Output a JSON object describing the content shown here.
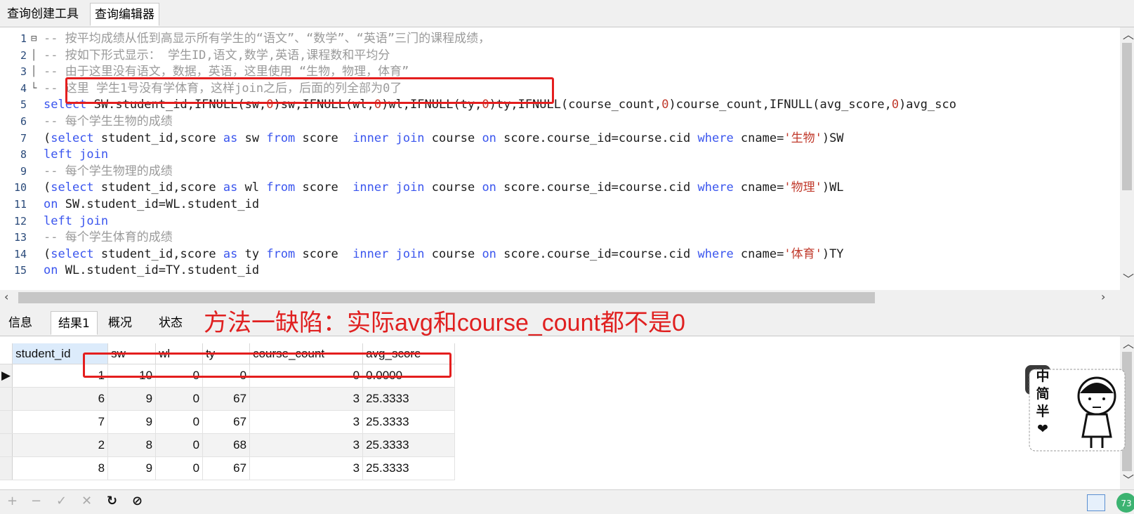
{
  "tabs": {
    "query_builder": "查询创建工具",
    "query_editor": "查询编辑器"
  },
  "editor": {
    "lines": [
      {
        "n": "1",
        "fold": "⊟",
        "parts": [
          {
            "c": "cmt",
            "t": "-- 按平均成绩从低到高显示所有学生的“语文”、“数学”、“英语”三门的课程成绩，"
          }
        ]
      },
      {
        "n": "2",
        "fold": "│",
        "parts": [
          {
            "c": "cmt",
            "t": "-- 按如下形式显示： 学生ID,语文,数学,英语,课程数和平均分"
          }
        ]
      },
      {
        "n": "3",
        "fold": "│",
        "parts": [
          {
            "c": "cmt",
            "t": "-- 由于这里没有语文，数据，英语，这里使用 “生物，物理，体育”"
          }
        ]
      },
      {
        "n": "4",
        "fold": "└",
        "parts": [
          {
            "c": "cmt",
            "t": "-- 这里 学生1号没有学体育，这样join之后，后面的列全部为0了"
          }
        ]
      },
      {
        "n": "5",
        "fold": "",
        "parts": [
          {
            "c": "kw",
            "t": "select"
          },
          {
            "c": "",
            "t": " SW.student_id,IFNULL(sw,"
          },
          {
            "c": "num",
            "t": "0"
          },
          {
            "c": "",
            "t": ")sw,IFNULL(wl,"
          },
          {
            "c": "num",
            "t": "0"
          },
          {
            "c": "",
            "t": ")wl,IFNULL(ty,"
          },
          {
            "c": "num",
            "t": "0"
          },
          {
            "c": "",
            "t": ")ty,IFNULL(course_count,"
          },
          {
            "c": "num",
            "t": "0"
          },
          {
            "c": "",
            "t": ")course_count,IFNULL(avg_score,"
          },
          {
            "c": "num",
            "t": "0"
          },
          {
            "c": "",
            "t": ")avg_sco"
          }
        ]
      },
      {
        "n": "6",
        "fold": "",
        "parts": [
          {
            "c": "cmt",
            "t": "-- 每个学生生物的成绩"
          }
        ]
      },
      {
        "n": "7",
        "fold": "",
        "parts": [
          {
            "c": "",
            "t": "("
          },
          {
            "c": "kw",
            "t": "select"
          },
          {
            "c": "",
            "t": " student_id,score "
          },
          {
            "c": "kw",
            "t": "as"
          },
          {
            "c": "",
            "t": " sw "
          },
          {
            "c": "kw",
            "t": "from"
          },
          {
            "c": "",
            "t": " score  "
          },
          {
            "c": "kw",
            "t": "inner join"
          },
          {
            "c": "",
            "t": " course "
          },
          {
            "c": "kw",
            "t": "on"
          },
          {
            "c": "",
            "t": " score.course_id=course.cid "
          },
          {
            "c": "kw",
            "t": "where"
          },
          {
            "c": "",
            "t": " cname="
          },
          {
            "c": "str",
            "t": "'生物'"
          },
          {
            "c": "",
            "t": ")SW"
          }
        ]
      },
      {
        "n": "8",
        "fold": "",
        "parts": [
          {
            "c": "kw",
            "t": "left join"
          }
        ]
      },
      {
        "n": "9",
        "fold": "",
        "parts": [
          {
            "c": "cmt",
            "t": "-- 每个学生物理的成绩"
          }
        ]
      },
      {
        "n": "10",
        "fold": "",
        "parts": [
          {
            "c": "",
            "t": "("
          },
          {
            "c": "kw",
            "t": "select"
          },
          {
            "c": "",
            "t": " student_id,score "
          },
          {
            "c": "kw",
            "t": "as"
          },
          {
            "c": "",
            "t": " wl "
          },
          {
            "c": "kw",
            "t": "from"
          },
          {
            "c": "",
            "t": " score  "
          },
          {
            "c": "kw",
            "t": "inner join"
          },
          {
            "c": "",
            "t": " course "
          },
          {
            "c": "kw",
            "t": "on"
          },
          {
            "c": "",
            "t": " score.course_id=course.cid "
          },
          {
            "c": "kw",
            "t": "where"
          },
          {
            "c": "",
            "t": " cname="
          },
          {
            "c": "str",
            "t": "'物理'"
          },
          {
            "c": "",
            "t": ")WL"
          }
        ]
      },
      {
        "n": "11",
        "fold": "",
        "parts": [
          {
            "c": "kw",
            "t": "on"
          },
          {
            "c": "",
            "t": " SW.student_id=WL.student_id"
          }
        ]
      },
      {
        "n": "12",
        "fold": "",
        "parts": [
          {
            "c": "kw",
            "t": "left join"
          }
        ]
      },
      {
        "n": "13",
        "fold": "",
        "parts": [
          {
            "c": "cmt",
            "t": "-- 每个学生体育的成绩"
          }
        ]
      },
      {
        "n": "14",
        "fold": "",
        "parts": [
          {
            "c": "",
            "t": "("
          },
          {
            "c": "kw",
            "t": "select"
          },
          {
            "c": "",
            "t": " student_id,score "
          },
          {
            "c": "kw",
            "t": "as"
          },
          {
            "c": "",
            "t": " ty "
          },
          {
            "c": "kw",
            "t": "from"
          },
          {
            "c": "",
            "t": " score  "
          },
          {
            "c": "kw",
            "t": "inner join"
          },
          {
            "c": "",
            "t": " course "
          },
          {
            "c": "kw",
            "t": "on"
          },
          {
            "c": "",
            "t": " score.course_id=course.cid "
          },
          {
            "c": "kw",
            "t": "where"
          },
          {
            "c": "",
            "t": " cname="
          },
          {
            "c": "str",
            "t": "'体育'"
          },
          {
            "c": "",
            "t": ")TY"
          }
        ]
      },
      {
        "n": "15",
        "fold": "",
        "parts": [
          {
            "c": "kw",
            "t": "on"
          },
          {
            "c": "",
            "t": " WL.student_id=TY.student_id"
          }
        ]
      }
    ]
  },
  "result_tabs": {
    "info": "信息",
    "result1": "结果1",
    "overview": "概况",
    "status": "状态"
  },
  "annotation": "方法一缺陷：实际avg和course_count都不是0",
  "grid": {
    "columns": [
      "student_id",
      "sw",
      "wl",
      "ty",
      "course_count",
      "avg_score"
    ],
    "rows": [
      [
        "1",
        "10",
        "0",
        "0",
        "0",
        "0.0000"
      ],
      [
        "6",
        "9",
        "0",
        "67",
        "3",
        "25.3333"
      ],
      [
        "7",
        "9",
        "0",
        "67",
        "3",
        "25.3333"
      ],
      [
        "2",
        "8",
        "0",
        "68",
        "3",
        "25.3333"
      ],
      [
        "8",
        "9",
        "0",
        "67",
        "3",
        "25.3333"
      ]
    ]
  },
  "toolbar": {
    "add": "+",
    "remove": "−",
    "apply": "✓",
    "discard": "✕",
    "refresh": "↻",
    "stop": "⊘"
  },
  "sticker": {
    "text": "中简半❤"
  },
  "status_badge": "73",
  "colors": {
    "annotation_red": "#e02020",
    "keyword_blue": "#3a55ee",
    "string_red": "#c0392b",
    "comment_gray": "#9a9a9a"
  }
}
